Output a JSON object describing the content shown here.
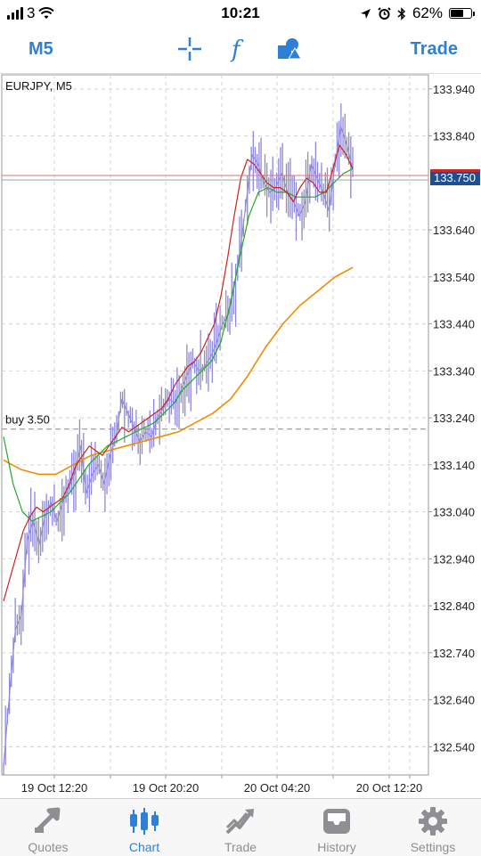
{
  "status_bar": {
    "carrier": "3",
    "time": "10:21",
    "battery": "62%",
    "battery_level": 0.62
  },
  "toolbar": {
    "timeframe_label": "M5",
    "trade_label": "Trade",
    "icons": [
      "crosshair-icon",
      "indicators-icon",
      "objects-icon"
    ]
  },
  "chart": {
    "symbol_label": "EURJPY, M5",
    "order_label": "buy 3.50",
    "current_price": "133.750",
    "colors": {
      "candle": "#8e88d8",
      "fast_ma": "#cc2222",
      "mid_ma": "#22aa22",
      "slow_ma": "#f08c00",
      "price_line": "#e07070",
      "price_box": "#1f4f8f"
    }
  },
  "chart_data": {
    "type": "line",
    "y_ticks": [
      "133.940",
      "133.840",
      "133.750",
      "133.640",
      "133.540",
      "133.440",
      "133.340",
      "133.240",
      "133.140",
      "133.040",
      "132.940",
      "132.840",
      "132.740",
      "132.640",
      "132.540"
    ],
    "x_ticks": [
      "19 Oct 12:20",
      "19 Oct 20:20",
      "20 Oct 04:20",
      "20 Oct 12:20"
    ],
    "ylim": [
      132.48,
      133.97
    ],
    "buy_level": 133.216,
    "series": [
      {
        "kind": "price",
        "values": [
          132.5,
          132.65,
          132.79,
          132.82,
          132.98,
          133.02,
          132.97,
          133.03,
          133.06,
          133.02,
          133.06,
          133.09,
          133.12,
          133.18,
          133.08,
          133.12,
          133.14,
          133.1,
          133.16,
          133.2,
          133.28,
          133.25,
          133.22,
          133.19,
          133.21,
          133.2,
          133.24,
          133.26,
          133.28,
          133.27,
          133.3,
          133.33,
          133.36,
          133.34,
          133.35,
          133.37,
          133.4,
          133.44,
          133.46,
          133.52,
          133.6,
          133.7,
          133.8,
          133.78,
          133.74,
          133.72,
          133.73,
          133.76,
          133.72,
          133.7,
          133.67,
          133.7,
          133.78,
          133.75,
          133.72,
          133.68,
          133.78,
          133.86,
          133.82,
          133.77
        ]
      },
      {
        "kind": "fast_ma",
        "values": [
          132.85,
          132.9,
          132.95,
          133.0,
          133.03,
          133.05,
          133.04,
          133.05,
          133.06,
          133.07,
          133.1,
          133.14,
          133.16,
          133.18,
          133.17,
          133.16,
          133.18,
          133.2,
          133.22,
          133.21,
          133.22,
          133.23,
          133.24,
          133.25,
          133.26,
          133.28,
          133.31,
          133.33,
          133.35,
          133.36,
          133.38,
          133.41,
          133.44,
          133.5,
          133.58,
          133.67,
          133.75,
          133.79,
          133.78,
          133.76,
          133.74,
          133.73,
          133.73,
          133.72,
          133.7,
          133.73,
          133.75,
          133.74,
          133.72,
          133.72,
          133.77,
          133.82,
          133.8,
          133.77
        ]
      },
      {
        "kind": "mid_ma",
        "values": [
          133.2,
          133.1,
          133.04,
          133.02,
          133.03,
          133.04,
          133.06,
          133.08,
          133.11,
          133.14,
          133.16,
          133.18,
          133.19,
          133.2,
          133.21,
          133.22,
          133.23,
          133.25,
          133.27,
          133.3,
          133.32,
          133.34,
          133.36,
          133.4,
          133.48,
          133.58,
          133.67,
          133.72,
          133.73,
          133.72,
          133.72,
          133.71,
          133.71,
          133.71,
          133.72,
          133.74,
          133.76,
          133.77
        ]
      },
      {
        "kind": "slow_ma",
        "values": [
          133.15,
          133.13,
          133.12,
          133.12,
          133.14,
          133.16,
          133.17,
          133.18,
          133.19,
          133.2,
          133.21,
          133.23,
          133.25,
          133.28,
          133.33,
          133.39,
          133.44,
          133.48,
          133.51,
          133.54,
          133.56
        ]
      }
    ]
  },
  "tabs": [
    {
      "label": "Quotes",
      "icon": "quotes-icon",
      "active": false
    },
    {
      "label": "Chart",
      "icon": "chart-icon",
      "active": true
    },
    {
      "label": "Trade",
      "icon": "trade-icon",
      "active": false
    },
    {
      "label": "History",
      "icon": "history-icon",
      "active": false
    },
    {
      "label": "Settings",
      "icon": "settings-icon",
      "active": false
    }
  ]
}
